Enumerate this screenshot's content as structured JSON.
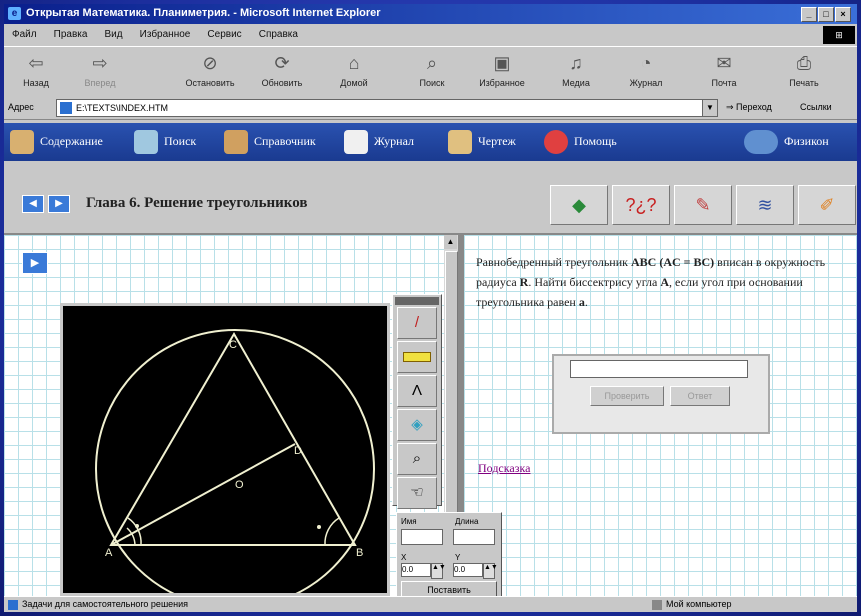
{
  "window": {
    "title": "Открытая Математика. Планиметрия. - Microsoft Internet Explorer",
    "icon": "ie-icon"
  },
  "menu": [
    "Файл",
    "Правка",
    "Вид",
    "Избранное",
    "Сервис",
    "Справка"
  ],
  "toolbar": [
    {
      "label": "Назад",
      "icon": "back-arrow-icon",
      "disabled": false
    },
    {
      "label": "Вперед",
      "icon": "forward-arrow-icon",
      "disabled": true
    },
    {
      "label": "Остановить",
      "icon": "stop-icon",
      "disabled": false
    },
    {
      "label": "Обновить",
      "icon": "refresh-icon",
      "disabled": false
    },
    {
      "label": "Домой",
      "icon": "home-icon",
      "disabled": false
    },
    {
      "label": "Поиск",
      "icon": "search-icon",
      "disabled": false
    },
    {
      "label": "Избранное",
      "icon": "favorites-icon",
      "disabled": false
    },
    {
      "label": "Медиа",
      "icon": "media-icon",
      "disabled": false
    },
    {
      "label": "Журнал",
      "icon": "history-icon",
      "disabled": false
    },
    {
      "label": "Почта",
      "icon": "mail-icon",
      "disabled": false
    },
    {
      "label": "Печать",
      "icon": "print-icon",
      "disabled": false
    }
  ],
  "address": {
    "label": "Адрес",
    "value": "E:\\TEXTS\\INDEX.HTM",
    "go": "Переход",
    "links": "Ссылки"
  },
  "nav": [
    {
      "label": "Содержание",
      "icon": "book-icon",
      "color": "#d8b070"
    },
    {
      "label": "Поиск",
      "icon": "magnifier-icon",
      "color": "#a0c8e0"
    },
    {
      "label": "Справочник",
      "icon": "open-book-icon",
      "color": "#d0a060"
    },
    {
      "label": "Журнал",
      "icon": "journal-icon",
      "color": "#f0f0f0"
    },
    {
      "label": "Чертеж",
      "icon": "drawing-icon",
      "color": "#e0c080"
    },
    {
      "label": "Помощь",
      "icon": "lifebuoy-icon",
      "color": "#e04040"
    },
    {
      "label": "Физикон",
      "icon": "globe-icon",
      "color": "#6090d0"
    }
  ],
  "chapter": {
    "title": "Глава 6. Решение треугольников"
  },
  "chapter_buttons": [
    {
      "icon": "green-book-icon",
      "color": "#2a8a3a"
    },
    {
      "icon": "question-marks-icon",
      "color": "#c82020"
    },
    {
      "icon": "pencil-icon",
      "color": "#c04040"
    },
    {
      "icon": "footprints-icon",
      "color": "#3050a0"
    },
    {
      "icon": "orange-pencils-icon",
      "color": "#e08020"
    }
  ],
  "drawing": {
    "labels": {
      "A": "A",
      "B": "B",
      "C": "C",
      "O": "O",
      "D": "D"
    },
    "stroke": "#f0f0d0"
  },
  "tools": [
    {
      "icon": "pen-icon"
    },
    {
      "icon": "ruler-icon"
    },
    {
      "icon": "compass-icon"
    },
    {
      "icon": "eraser-icon"
    },
    {
      "icon": "zoom-icon"
    },
    {
      "icon": "hand-icon"
    }
  ],
  "coords": {
    "name_label": "Имя",
    "dist_label": "Длина",
    "x_label": "X",
    "y_label": "Y",
    "x_value": "0.0",
    "y_value": "0.0",
    "place_label": "Поставить"
  },
  "problem": {
    "text_parts": [
      {
        "t": "Равнобедренный треугольник "
      },
      {
        "t": "ABC (AC = BC)",
        "b": true
      },
      {
        "t": " вписан в окружность радиуса "
      },
      {
        "t": "R",
        "b": true
      },
      {
        "t": ". Найти биссектрису угла "
      },
      {
        "t": "A",
        "b": true
      },
      {
        "t": ", если угол при основании треугольника равен "
      },
      {
        "t": "a",
        "b": true
      },
      {
        "t": "."
      }
    ]
  },
  "answer": {
    "value": "",
    "check_label": "Проверить",
    "answer_label": "Ответ"
  },
  "hint": "Подсказка",
  "status": {
    "left": "Задачи для самостоятельного решения",
    "right": "Мой компьютер"
  }
}
